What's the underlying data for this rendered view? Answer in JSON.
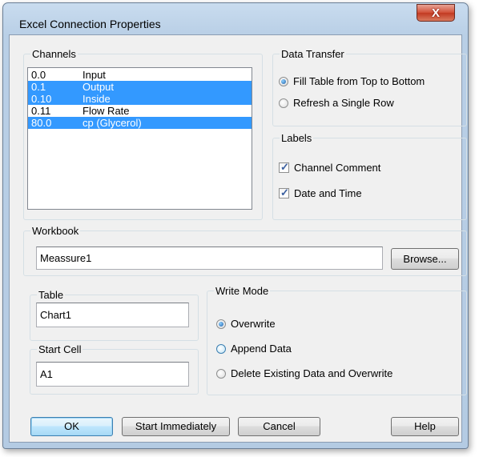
{
  "window": {
    "title": "Excel Connection Properties",
    "close_glyph": "X"
  },
  "channels": {
    "legend": "Channels",
    "rows": [
      {
        "id": "0.0",
        "name": "Input",
        "selected": false
      },
      {
        "id": "0.1",
        "name": "Output",
        "selected": true
      },
      {
        "id": "0.10",
        "name": "Inside",
        "selected": true
      },
      {
        "id": "0.11",
        "name": "Flow Rate",
        "selected": false
      },
      {
        "id": "80.0",
        "name": "cp (Glycerol)",
        "selected": true
      }
    ]
  },
  "data_transfer": {
    "legend": "Data Transfer",
    "options": [
      {
        "label": "Fill Table from Top to Bottom",
        "checked": true
      },
      {
        "label": "Refresh a Single Row",
        "checked": false
      }
    ]
  },
  "labels": {
    "legend": "Labels",
    "options": [
      {
        "label": "Channel Comment",
        "checked": true
      },
      {
        "label": "Date and Time",
        "checked": true
      }
    ]
  },
  "workbook": {
    "legend": "Workbook",
    "value": "Meassure1",
    "browse_label": "Browse..."
  },
  "table": {
    "legend": "Table",
    "value": "Chart1"
  },
  "start_cell": {
    "legend": "Start Cell",
    "value": "A1"
  },
  "write_mode": {
    "legend": "Write Mode",
    "options": [
      {
        "label": "Overwrite",
        "checked": true
      },
      {
        "label": "Append Data",
        "checked": false
      },
      {
        "label": "Delete Existing Data and Overwrite",
        "checked": false
      }
    ]
  },
  "buttons": {
    "ok": "OK",
    "start": "Start Immediately",
    "cancel": "Cancel",
    "help": "Help"
  },
  "colors": {
    "selection": "#3399ff",
    "title_bar": "#b9cfe6",
    "dialog": "#f0f0f0",
    "close": "#c94a30"
  }
}
